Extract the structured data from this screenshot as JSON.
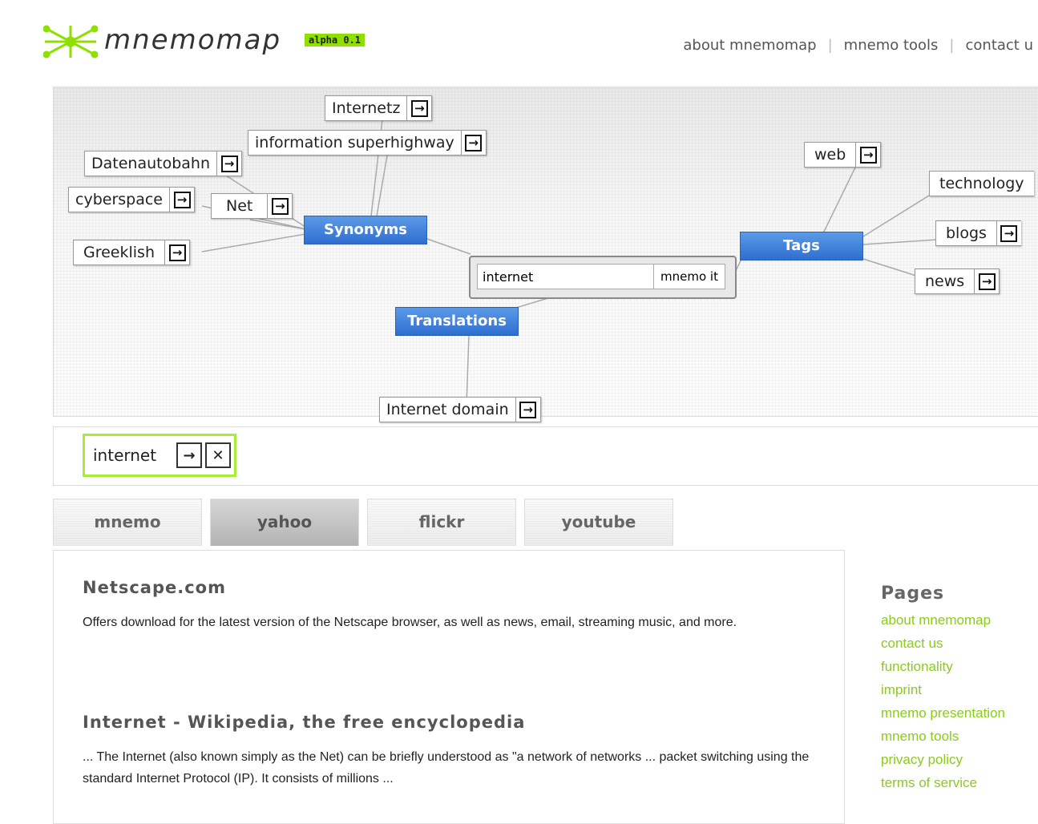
{
  "header": {
    "logo_text": "mnemomap",
    "badge": "alpha 0.1",
    "nav": [
      "about mnemomap",
      "mnemo tools",
      "contact u"
    ]
  },
  "map": {
    "center": {
      "value": "internet",
      "button": "mnemo it"
    },
    "categories": {
      "synonyms": "Synonyms",
      "translations": "Translations",
      "tags": "Tags"
    },
    "nodes": {
      "internetz": "Internetz",
      "info_superhighway": "information superhighway",
      "datenautobahn": "Datenautobahn",
      "cyberspace": "cyberspace",
      "net": "Net",
      "greeklish": "Greeklish",
      "internet_domain": "Internet domain",
      "web": "web",
      "technology": "technology",
      "blogs": "blogs",
      "news": "news"
    },
    "go_glyph": "→"
  },
  "history": {
    "item": "internet",
    "go_glyph": "→",
    "close_glyph": "✕"
  },
  "tabs": [
    "mnemo",
    "yahoo",
    "flickr",
    "youtube"
  ],
  "active_tab": "yahoo",
  "results": [
    {
      "title": "Netscape.com",
      "snippet": "Offers download for the latest version of the Netscape browser, as well as news, email, streaming music, and more."
    },
    {
      "title": "Internet - Wikipedia, the free encyclopedia",
      "snippet": "... The Internet (also known simply as the Net) can be briefly understood as \"a network of networks ... packet switching using the standard Internet Protocol (IP). It consists of millions ..."
    }
  ],
  "pages": {
    "title": "Pages",
    "links": [
      "about mnemomap",
      "contact us",
      "functionality",
      "imprint",
      "mnemo presentation",
      "mnemo tools",
      "privacy policy",
      "terms of service"
    ]
  },
  "colors": {
    "accent_green": "#8acb1c",
    "category_blue": "#3a7bd8"
  }
}
